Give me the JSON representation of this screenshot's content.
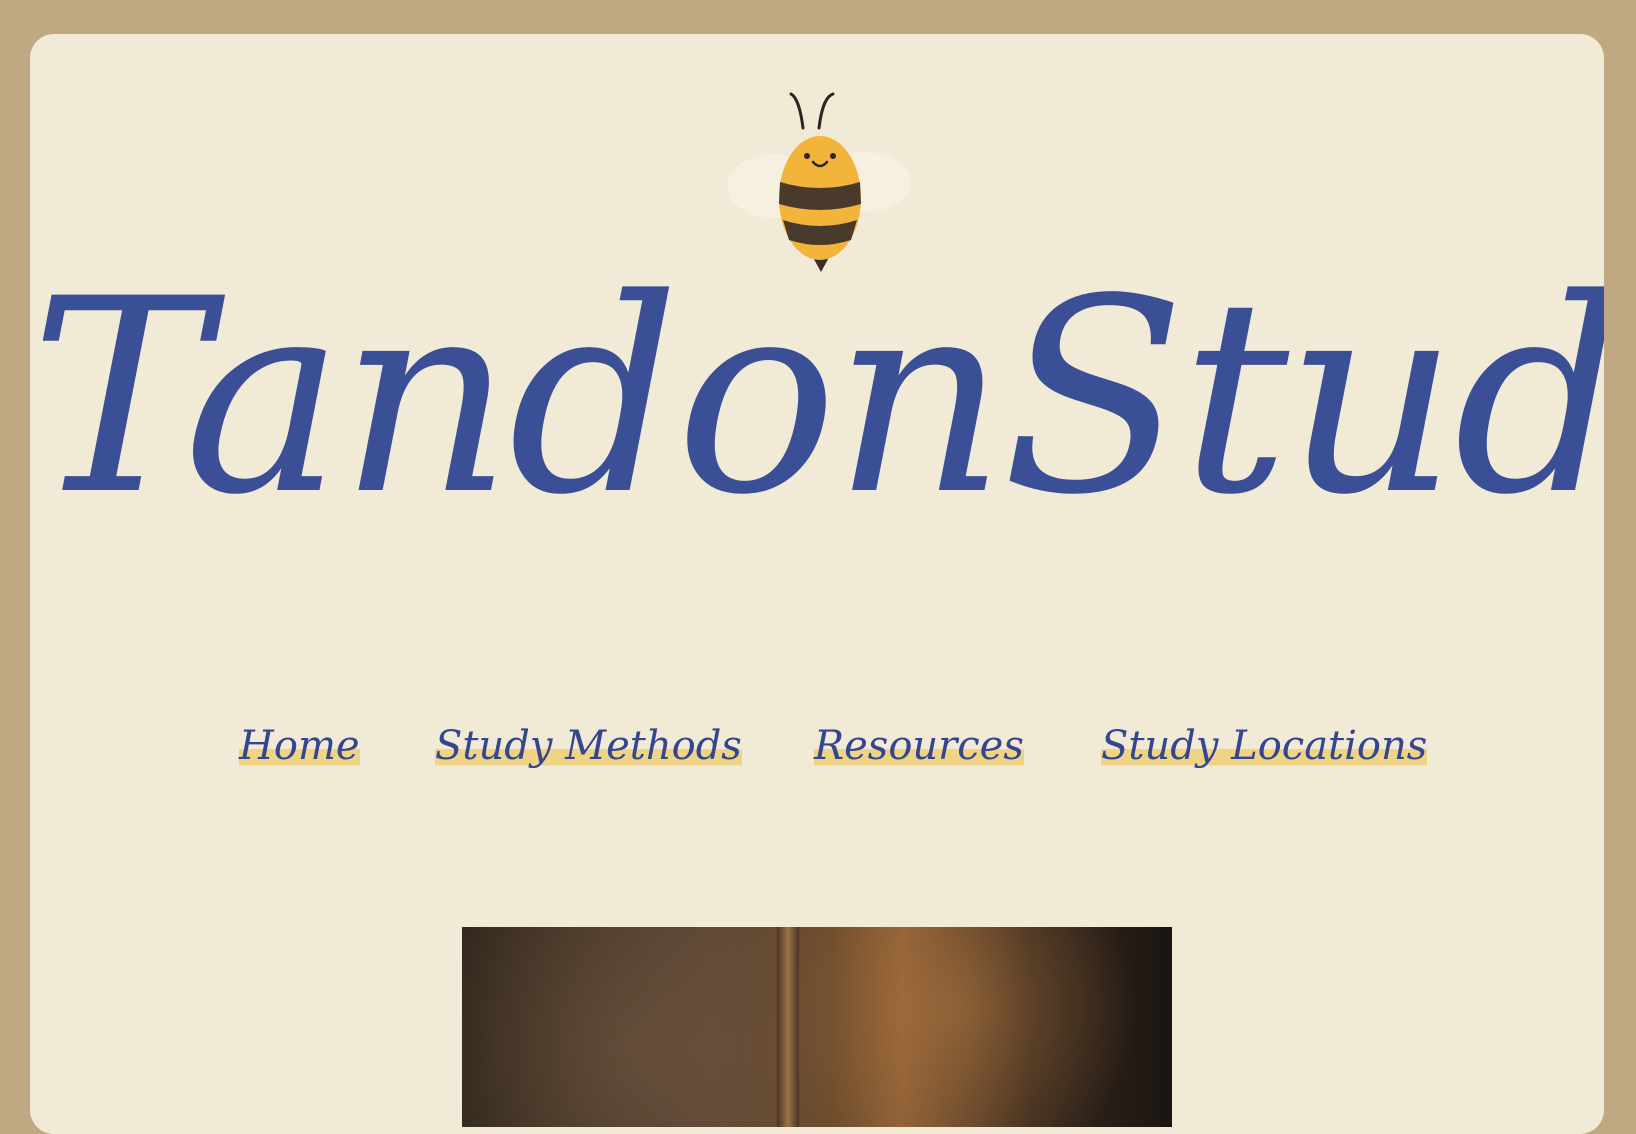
{
  "site": {
    "title": "TandonStudy",
    "logo_icon": "bee-icon"
  },
  "nav": {
    "items": [
      {
        "label": "Home"
      },
      {
        "label": "Study Methods"
      },
      {
        "label": "Resources"
      },
      {
        "label": "Study Locations"
      }
    ]
  },
  "hero": {
    "image_icon": "study-photo-image"
  },
  "colors": {
    "page_border": "#c0a882",
    "card_background": "#f0ead6",
    "title_blue": "#3b4f96",
    "nav_highlight": "#f0d485",
    "bee_yellow": "#f2b43b",
    "bee_stripe": "#4a3a2c"
  }
}
